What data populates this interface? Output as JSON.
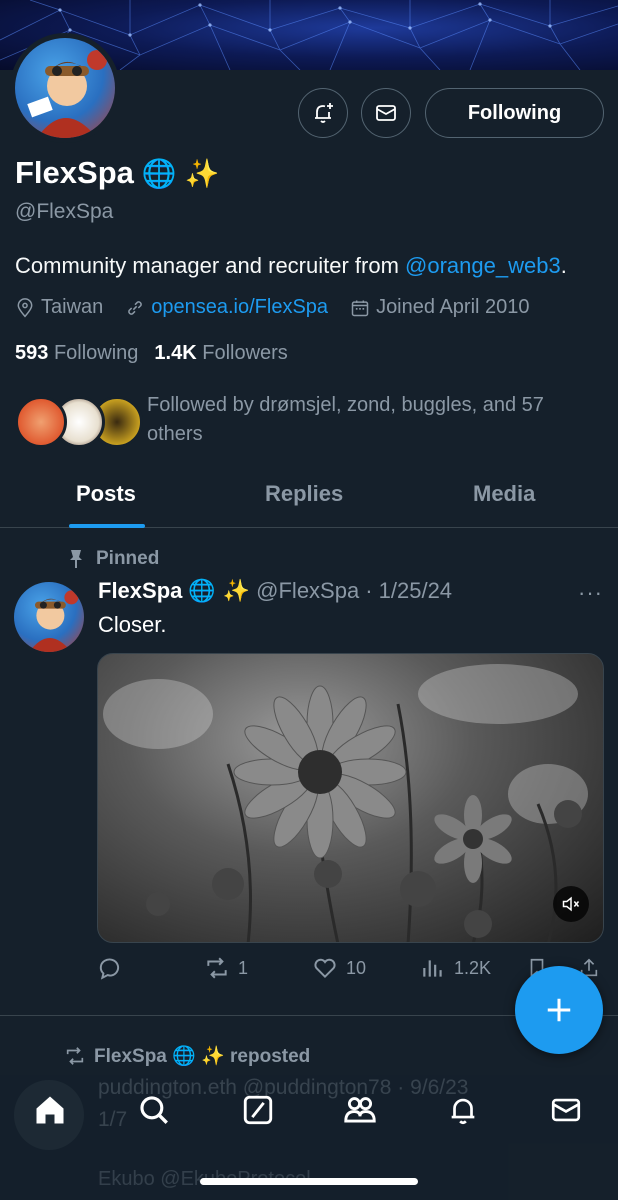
{
  "profile": {
    "display_name": "FlexSpa",
    "badge_emojis": [
      "🌐",
      "✨"
    ],
    "handle": "@FlexSpa",
    "bio_text": "Community manager and recruiter from ",
    "bio_mention": "@orange_web3",
    "bio_end": ".",
    "location": "Taiwan",
    "website": "opensea.io/FlexSpa",
    "joined": "Joined April 2010",
    "following_count": "593",
    "following_label": "Following",
    "followers_count": "1.4K",
    "followers_label": "Followers",
    "followed_by": "Followed by drømsjel, zond, buggles, and 57 others"
  },
  "header_actions": {
    "notify_icon": "bell-plus-icon",
    "message_icon": "mail-icon",
    "follow_label": "Following"
  },
  "tabs": [
    {
      "label": "Posts",
      "active": true
    },
    {
      "label": "Replies",
      "active": false
    },
    {
      "label": "Media",
      "active": false
    }
  ],
  "pinned_post": {
    "pinned_label": "Pinned",
    "author_name": "FlexSpa",
    "author_emojis": "🌐 ✨",
    "author_handle": "@FlexSpa",
    "date": "· 1/25/24",
    "text": "Closer.",
    "more": "···",
    "media_alt": "black and white flowers photo",
    "stats": {
      "replies": "",
      "reposts": "1",
      "likes": "10",
      "views": "1.2K"
    }
  },
  "next_post": {
    "repost_label": "FlexSpa 🌐 ✨ reposted",
    "author_line": "puddington.eth @puddington78 · 9/6/23",
    "text": "1/7",
    "next_author": "Ekubo @EkuboProtocol"
  },
  "fab_icon": "plus-icon",
  "nav": [
    "home-icon",
    "search-icon",
    "grok-icon",
    "communities-icon",
    "notifications-icon",
    "messages-icon"
  ],
  "colors": {
    "background": "#15202b",
    "accent": "#1d9bf0",
    "muted": "#8b98a5",
    "border": "#38444d"
  }
}
